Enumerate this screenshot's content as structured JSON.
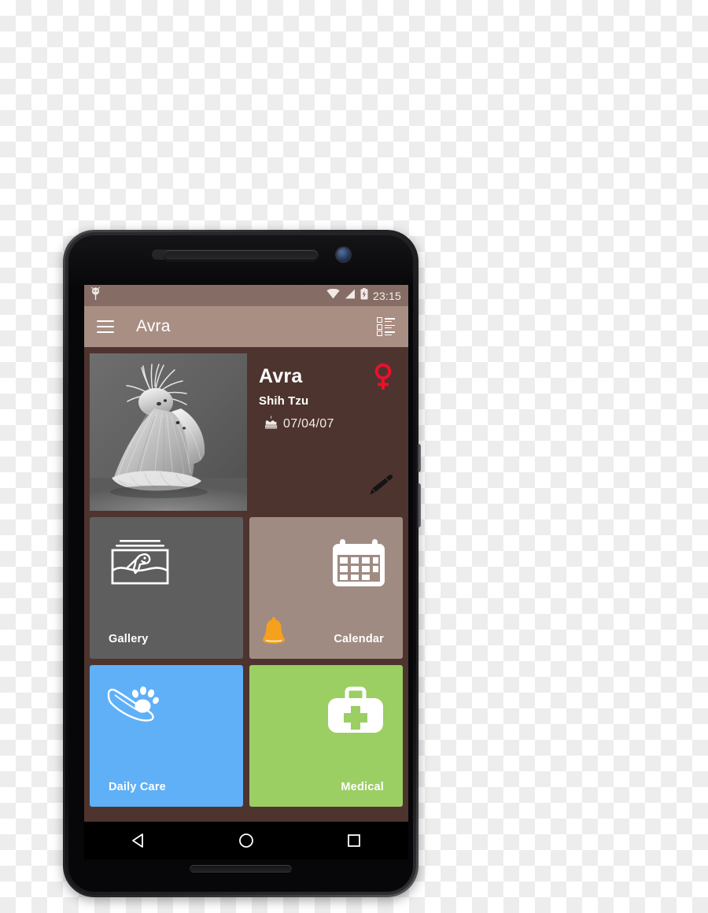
{
  "device": {
    "name": "android-smartphone-mockup",
    "hardware": {
      "earpiece": "earpiece-speaker",
      "front_camera": "front-camera",
      "proximity_sensor": "proximity-sensor",
      "bottom_speaker": "bottom-speaker",
      "power_button": "power-button",
      "volume_button": "volume-button"
    }
  },
  "status_bar": {
    "notification_icon": "android-notification-icon",
    "wifi_icon": "wifi-icon",
    "signal_icon": "cellular-signal-icon",
    "battery_icon": "battery-charging-icon",
    "clock": "23:15",
    "background": "#856d65"
  },
  "app_bar": {
    "menu_icon": "hamburger-menu-icon",
    "title": "Avra",
    "list_icon": "checklist-icon",
    "background": "#a98e84"
  },
  "profile": {
    "photo_alt": "shih-tzu-portrait",
    "name": "Avra",
    "breed": "Shih Tzu",
    "birthday_icon": "birthday-cake-icon",
    "birthday": "07/04/07",
    "gender_icon": "female-gender-icon",
    "gender_color": "#e8112d",
    "edit_icon": "edit-pencil-icon",
    "background": "#4e342e"
  },
  "tiles": [
    {
      "id": "gallery",
      "label": "Gallery",
      "icon": "photo-gallery-icon",
      "color": "#5e5e5e",
      "align": "left"
    },
    {
      "id": "calendar",
      "label": "Calendar",
      "icon": "calendar-icon",
      "badge_icon": "bell-reminder-icon",
      "badge_color": "#f5a11e",
      "color": "#a08b82",
      "align": "right"
    },
    {
      "id": "daily-care",
      "label": "Daily Care",
      "icon": "paw-care-icon",
      "color": "#5fb0f7",
      "align": "left"
    },
    {
      "id": "medical",
      "label": "Medical",
      "icon": "medical-kit-icon",
      "color": "#9bce63",
      "align": "right"
    }
  ],
  "nav_bar": {
    "back": "back-triangle-icon",
    "home": "home-circle-icon",
    "recents": "recents-square-icon",
    "background": "#000000"
  }
}
